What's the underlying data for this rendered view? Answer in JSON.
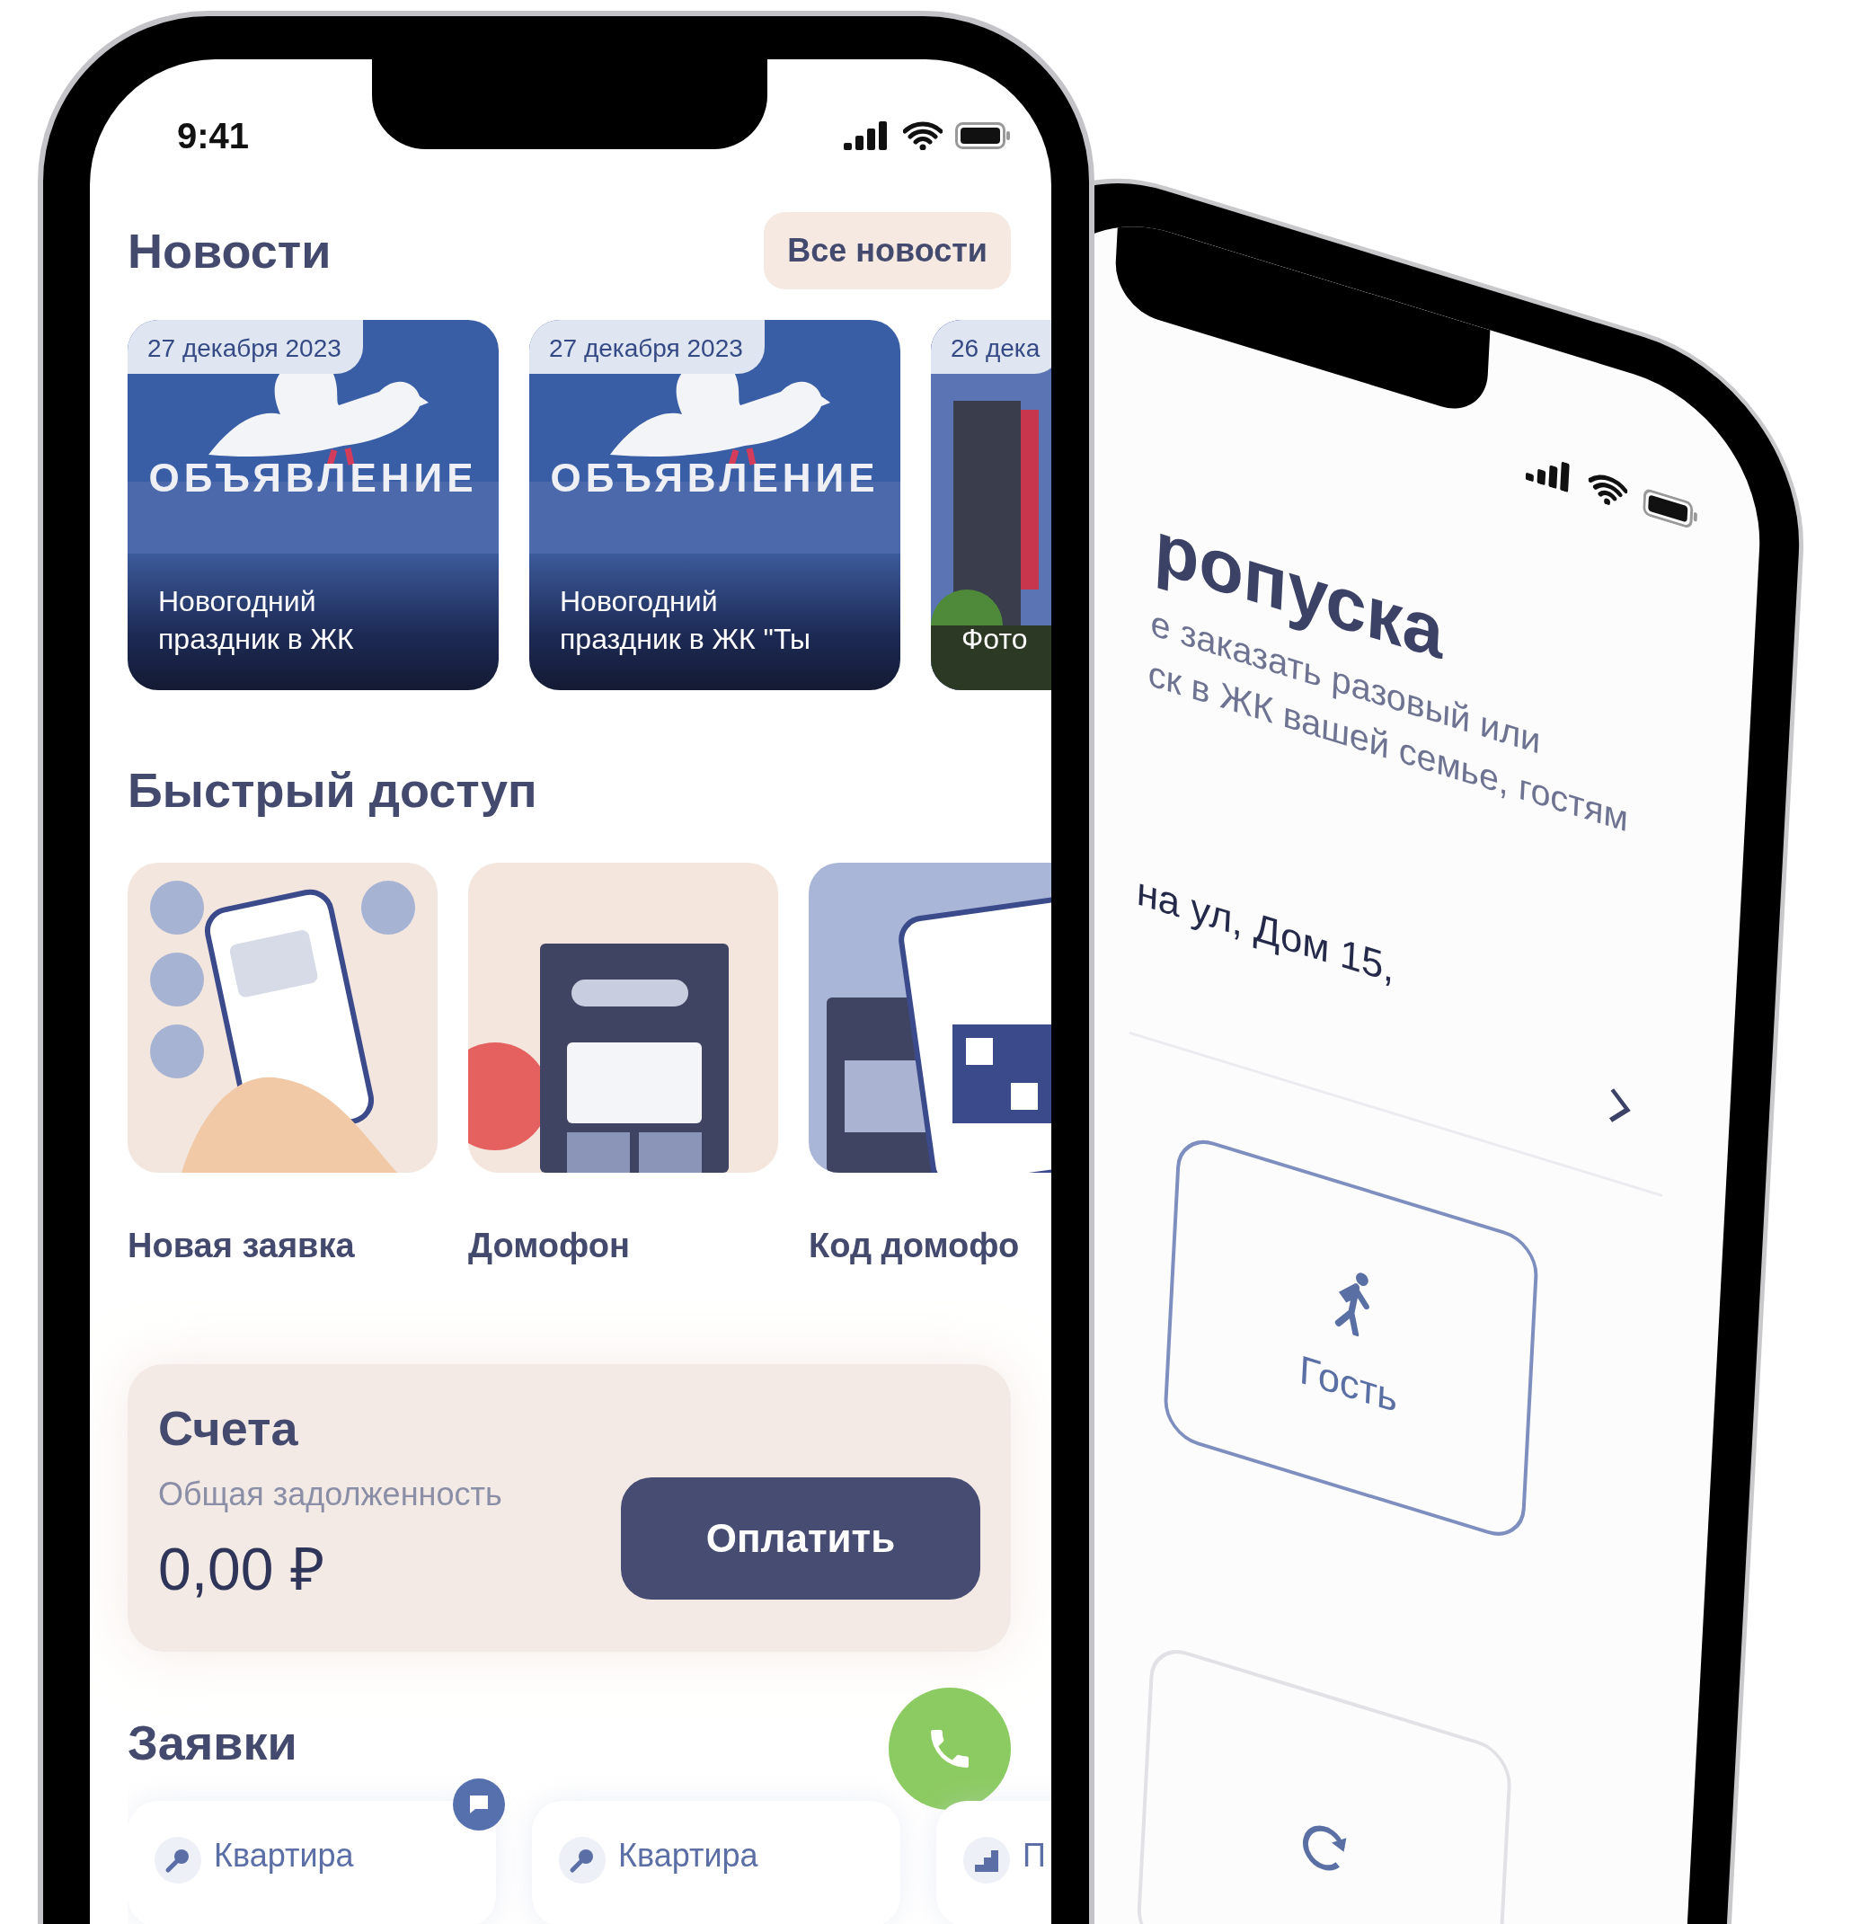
{
  "front": {
    "status_bar": {
      "time": "9:41"
    },
    "news": {
      "title": "Новости",
      "all_button": "Все новости",
      "items": [
        {
          "date": "27 декабря 2023",
          "kind": "announcement",
          "banner": "ОБЪЯВЛЕНИЕ",
          "title": "Новогодний\nпраздник в ЖК"
        },
        {
          "date": "27 декабря 2023",
          "kind": "announcement",
          "banner": "ОБЪЯВЛЕНИЕ",
          "title": "Новогодний\nпраздник в ЖК \"Ты"
        },
        {
          "date": "26 дека",
          "kind": "photo",
          "title": "Фото"
        }
      ]
    },
    "quick_access": {
      "title": "Быстрый доступ",
      "items": [
        {
          "label": "Новая заявка",
          "kind": "request"
        },
        {
          "label": "Домофон",
          "kind": "intercom"
        },
        {
          "label": "Код домофо",
          "kind": "code"
        }
      ]
    },
    "bills": {
      "title": "Счета",
      "subtitle": "Общая задолженность",
      "amount": "0,00 ₽",
      "pay_button": "Оплатить"
    },
    "requests": {
      "title": "Заявки",
      "items": [
        {
          "label": "Квартира",
          "kind": "key"
        },
        {
          "label": "Квартира",
          "kind": "key"
        },
        {
          "label": "П",
          "kind": "stairs"
        }
      ]
    }
  },
  "back": {
    "title": "ропуска",
    "description": "е заказать разовый или\nск в ЖК вашей семье, гостям",
    "address": "на ул, Дом 15,",
    "pass_types": [
      {
        "label": "Гость",
        "kind": "guest"
      },
      {
        "kind": "recurring"
      }
    ]
  }
}
